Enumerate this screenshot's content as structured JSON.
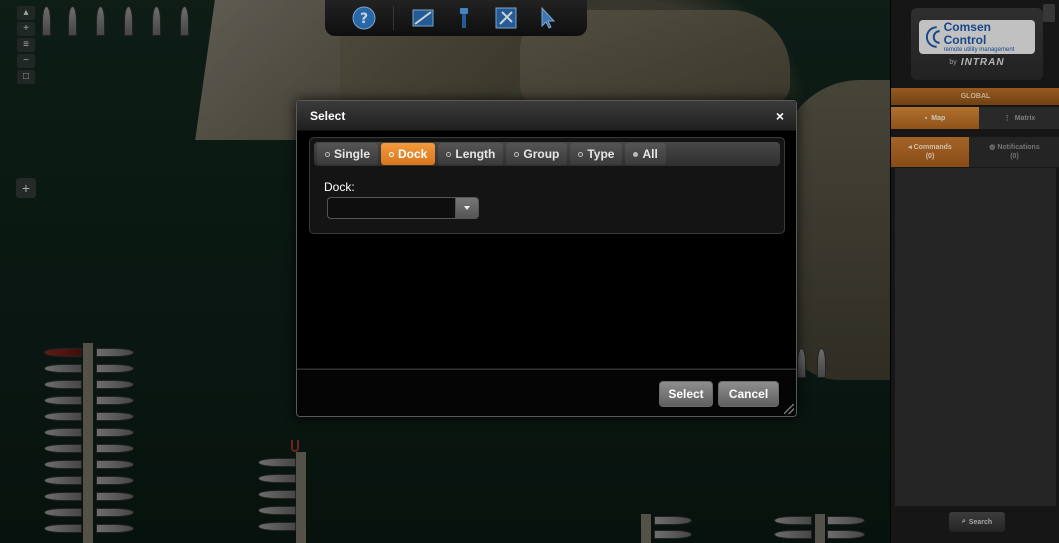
{
  "toolbar": {
    "tools": [
      {
        "name": "help",
        "icon": "help-circle-icon"
      },
      {
        "name": "map-area",
        "icon": "map-area-icon"
      },
      {
        "name": "meter",
        "icon": "meter-icon"
      },
      {
        "name": "tools",
        "icon": "tools-icon"
      },
      {
        "name": "pointer",
        "icon": "pointer-icon"
      }
    ]
  },
  "panel": {
    "logo": {
      "name": "Comsen Control",
      "sub": "remote utility management",
      "by": "by",
      "brand": "INTRAN"
    },
    "global_label": "GLOBAL",
    "tabs": {
      "map": "Map",
      "matrix": "Matrix"
    },
    "subtabs": {
      "commands": "Commands",
      "commands_count": "(0)",
      "notifications": "Notifications",
      "notifications_count": "(0)"
    },
    "search_label": "Search"
  },
  "modal": {
    "title": "Select",
    "close": "×",
    "tabs": [
      {
        "label": "Single",
        "active": false
      },
      {
        "label": "Dock",
        "active": true
      },
      {
        "label": "Length",
        "active": false
      },
      {
        "label": "Group",
        "active": false
      },
      {
        "label": "Type",
        "active": false
      },
      {
        "label": "All",
        "active": false
      }
    ],
    "dock_label": "Dock:",
    "dock_value": "",
    "select_button": "Select",
    "cancel_button": "Cancel"
  },
  "map": {
    "slip_marker": "U"
  },
  "colors": {
    "accent": "#e8862a",
    "panel_bg": "#1b1b1b",
    "water": "#163126"
  }
}
